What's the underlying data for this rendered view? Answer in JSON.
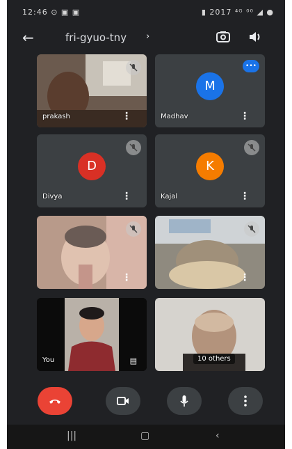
{
  "status_bar": {
    "time": "12:46 ⊙ ▣ ▣",
    "right": "▮ 2017 ⁴ᴳ ⁰⁰ ◢ ●"
  },
  "top_bar": {
    "back_icon": "arrow-left-icon",
    "meeting_title": "fri-gyuo-tny",
    "chevron": "›",
    "flip_camera_icon": "camera-flip-icon",
    "speaker_icon": "speaker-icon"
  },
  "participants": [
    {
      "name": "prakash",
      "type": "video",
      "muted": true
    },
    {
      "name": "Madhav",
      "type": "avatar",
      "initial": "M",
      "color": "#1a73e8",
      "speaking": true
    },
    {
      "name": "Divya",
      "type": "avatar",
      "initial": "D",
      "color": "#d93025",
      "muted": true
    },
    {
      "name": "Kajal",
      "type": "avatar",
      "initial": "K",
      "color": "#f57c00",
      "muted": true
    },
    {
      "name": "",
      "type": "video",
      "muted": true
    },
    {
      "name": "",
      "type": "video",
      "muted": true
    },
    {
      "name": "You",
      "type": "video"
    },
    {
      "name": "10 others",
      "type": "video"
    }
  ],
  "controls": {
    "end_call_icon": "phone-end-icon",
    "camera_icon": "video-camera-icon",
    "mic_icon": "microphone-icon",
    "more_icon": "more-vertical-icon"
  },
  "nav_bar": {
    "recents": "|||",
    "home": "▢",
    "back": "‹"
  },
  "colors": {
    "background": "#202124",
    "tile": "#3c4043",
    "end_call": "#ea4335"
  }
}
